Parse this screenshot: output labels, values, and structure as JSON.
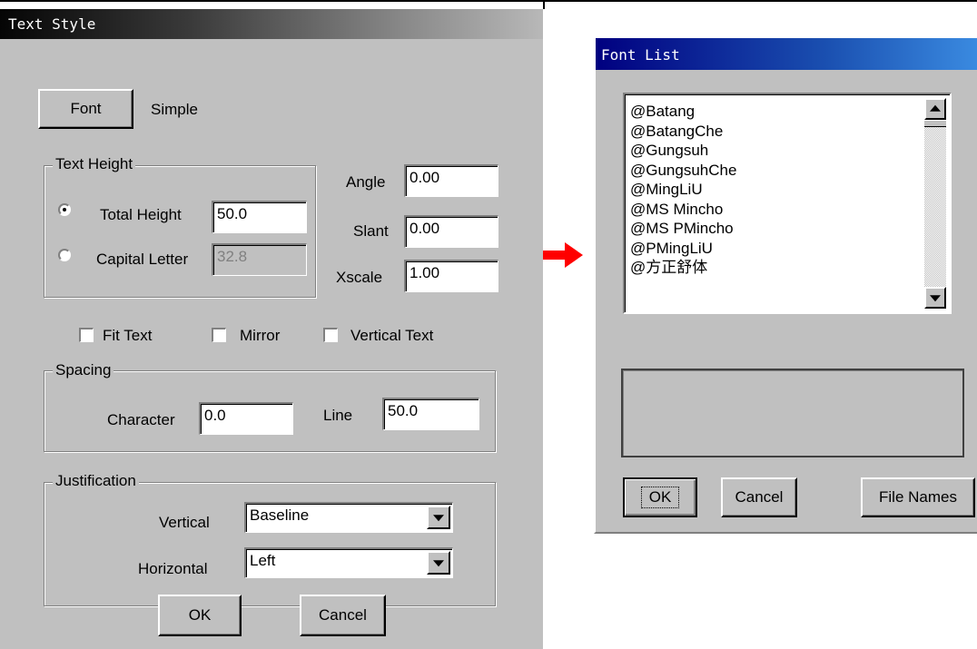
{
  "text_style_dialog": {
    "title": "Text Style",
    "font_button": "Font",
    "font_name": "Simple",
    "text_height": {
      "legend": "Text Height",
      "total_height_label": "Total Height",
      "total_height_value": "50.0",
      "total_height_selected": true,
      "capital_letter_label": "Capital Letter",
      "capital_letter_value": "32.8",
      "capital_letter_enabled": false
    },
    "angle_label": "Angle",
    "angle_value": "0.00",
    "slant_label": "Slant",
    "slant_value": "0.00",
    "xscale_label": "Xscale",
    "xscale_value": "1.00",
    "fit_text_label": "Fit Text",
    "fit_text_checked": false,
    "mirror_label": "Mirror",
    "mirror_checked": false,
    "vertical_text_label": "Vertical Text",
    "vertical_text_checked": false,
    "spacing": {
      "legend": "Spacing",
      "character_label": "Character",
      "character_value": "0.0",
      "line_label": "Line",
      "line_value": "50.0"
    },
    "justification": {
      "legend": "Justification",
      "vertical_label": "Vertical",
      "vertical_value": "Baseline",
      "horizontal_label": "Horizontal",
      "horizontal_value": "Left"
    },
    "ok_button": "OK",
    "cancel_button": "Cancel"
  },
  "transition_arrow_color": "#ff0000",
  "font_list_dialog": {
    "title": "Font List",
    "fonts": [
      "@Batang",
      "@BatangChe",
      "@Gungsuh",
      "@GungsuhChe",
      "@MingLiU",
      "@MS Mincho",
      "@MS PMincho",
      "@PMingLiU",
      "@方正舒体"
    ],
    "ok_button": "OK",
    "cancel_button": "Cancel",
    "file_names_button": "File Names"
  }
}
